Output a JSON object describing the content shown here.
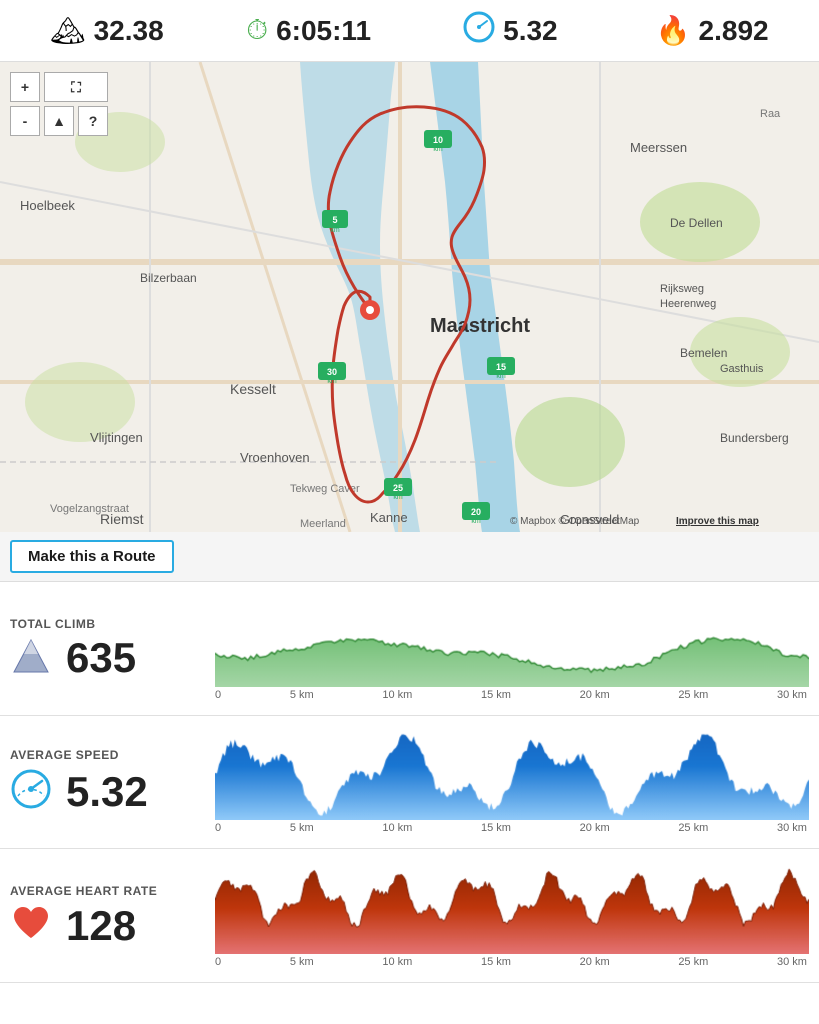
{
  "header": {
    "distance_icon": "🏔",
    "distance_value": "32.38",
    "time_icon": "⏱",
    "time_value": "6:05:11",
    "speed_icon": "🔵",
    "speed_value": "5.32",
    "fire_icon": "🔥",
    "fire_value": "2.892"
  },
  "map": {
    "city": "Maastricht",
    "attribution": "© Mapbox © OpenStreetMap",
    "improve_text": "Improve this map",
    "controls": {
      "zoom_in": "+",
      "zoom_out": "-",
      "fullscreen": "⛶",
      "terrain": "▲",
      "help": "?"
    }
  },
  "route_button": {
    "label": "Make this a Route"
  },
  "stats": {
    "climb": {
      "label": "TOTAL CLIMB",
      "value": "635",
      "icon": "mountain"
    },
    "speed": {
      "label": "AVERAGE SPEED",
      "value": "5.32",
      "icon": "speedometer"
    },
    "heart": {
      "label": "AVERAGE HEART RATE",
      "value": "128",
      "icon": "heart"
    }
  },
  "chart_labels": [
    "0",
    "5 km",
    "10 km",
    "15 km",
    "20 km",
    "25 km",
    "30 km"
  ]
}
